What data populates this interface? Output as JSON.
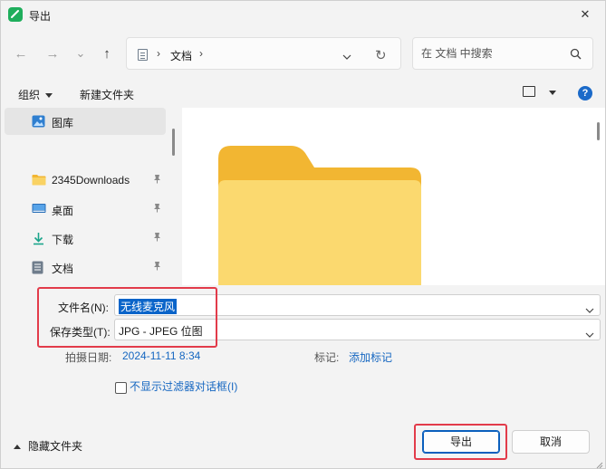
{
  "window": {
    "title": "导出",
    "close_symbol": "✕"
  },
  "nav": {
    "back_symbol": "←",
    "forward_symbol": "→",
    "recent_symbol": "⌄",
    "up_symbol": "↑",
    "address_separator": "›",
    "breadcrumb": "文档",
    "refresh_symbol": "↻",
    "search_placeholder": "在 文档 中搜索"
  },
  "toolbar": {
    "organize_label": "组织",
    "new_folder_label": "新建文件夹",
    "help_symbol": "?"
  },
  "sidebar": {
    "items": [
      {
        "label": "图库",
        "icon": "gallery-icon",
        "active": true,
        "pinned": false
      },
      {
        "label": "2345Downloads",
        "icon": "folder-icon",
        "active": false,
        "pinned": true
      },
      {
        "label": "桌面",
        "icon": "desktop-icon",
        "active": false,
        "pinned": true
      },
      {
        "label": "下载",
        "icon": "download-icon",
        "active": false,
        "pinned": true
      },
      {
        "label": "文档",
        "icon": "document-icon",
        "active": false,
        "pinned": true
      }
    ],
    "pin_symbol": "📌"
  },
  "form": {
    "filename_label": "文件名(N):",
    "filename_value": "无线麦克风",
    "filetype_label": "保存类型(T):",
    "filetype_value": "JPG - JPEG 位图",
    "date_label": "拍摄日期:",
    "date_value": "2024-11-11 8:34",
    "tags_label": "标记:",
    "tags_value": "添加标记",
    "checkbox_label": "不显示过滤器对话框(I)"
  },
  "footer": {
    "hide_folders_label": "隐藏文件夹",
    "export_button": "导出",
    "cancel_button": "取消"
  },
  "colors": {
    "accent": "#0a64c9",
    "highlight_box": "#e23b4a",
    "folder_yellow": "#f5c93e"
  }
}
